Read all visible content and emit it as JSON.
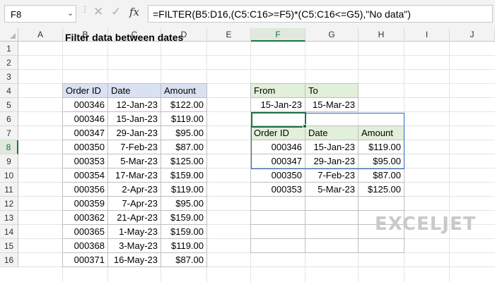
{
  "formula_bar": {
    "name_box": "F8",
    "cancel_glyph": "✕",
    "enter_glyph": "✓",
    "fx_label": "fx",
    "formula": "=FILTER(B5:D16,(C5:C16>=F5)*(C5:C16<=G5),\"No data\")"
  },
  "columns": [
    "A",
    "B",
    "C",
    "D",
    "E",
    "F",
    "G",
    "H",
    "I",
    "J"
  ],
  "rows": [
    "1",
    "2",
    "3",
    "4",
    "5",
    "6",
    "7",
    "8",
    "9",
    "10",
    "11",
    "12",
    "13",
    "14",
    "15",
    "16"
  ],
  "selected": {
    "column": "F",
    "row": "8"
  },
  "title": "Filter data between dates",
  "source_table": {
    "headers": [
      "Order ID",
      "Date",
      "Amount"
    ],
    "rows": [
      [
        "000346",
        "12-Jan-23",
        "$122.00"
      ],
      [
        "000346",
        "15-Jan-23",
        "$119.00"
      ],
      [
        "000347",
        "29-Jan-23",
        "$95.00"
      ],
      [
        "000350",
        "7-Feb-23",
        "$87.00"
      ],
      [
        "000353",
        "5-Mar-23",
        "$125.00"
      ],
      [
        "000354",
        "17-Mar-23",
        "$159.00"
      ],
      [
        "000356",
        "2-Apr-23",
        "$119.00"
      ],
      [
        "000359",
        "7-Apr-23",
        "$95.00"
      ],
      [
        "000362",
        "21-Apr-23",
        "$159.00"
      ],
      [
        "000365",
        "1-May-23",
        "$159.00"
      ],
      [
        "000368",
        "3-May-23",
        "$119.00"
      ],
      [
        "000371",
        "16-May-23",
        "$87.00"
      ]
    ]
  },
  "criteria": {
    "headers": [
      "From",
      "To"
    ],
    "values": [
      "15-Jan-23",
      "15-Mar-23"
    ]
  },
  "result_table": {
    "headers": [
      "Order ID",
      "Date",
      "Amount"
    ],
    "rows": [
      [
        "000346",
        "15-Jan-23",
        "$119.00"
      ],
      [
        "000347",
        "29-Jan-23",
        "$95.00"
      ],
      [
        "000350",
        "7-Feb-23",
        "$87.00"
      ],
      [
        "000353",
        "5-Mar-23",
        "$125.00"
      ],
      [
        "",
        "",
        ""
      ],
      [
        "",
        "",
        ""
      ],
      [
        "",
        "",
        ""
      ],
      [
        "",
        "",
        ""
      ]
    ]
  },
  "logo": "EXCELJET",
  "colors": {
    "header_blue": "#d9e1f2",
    "header_green": "#e2efda",
    "selection_green": "#1e7145",
    "spill_blue": "#2f6ac4"
  }
}
